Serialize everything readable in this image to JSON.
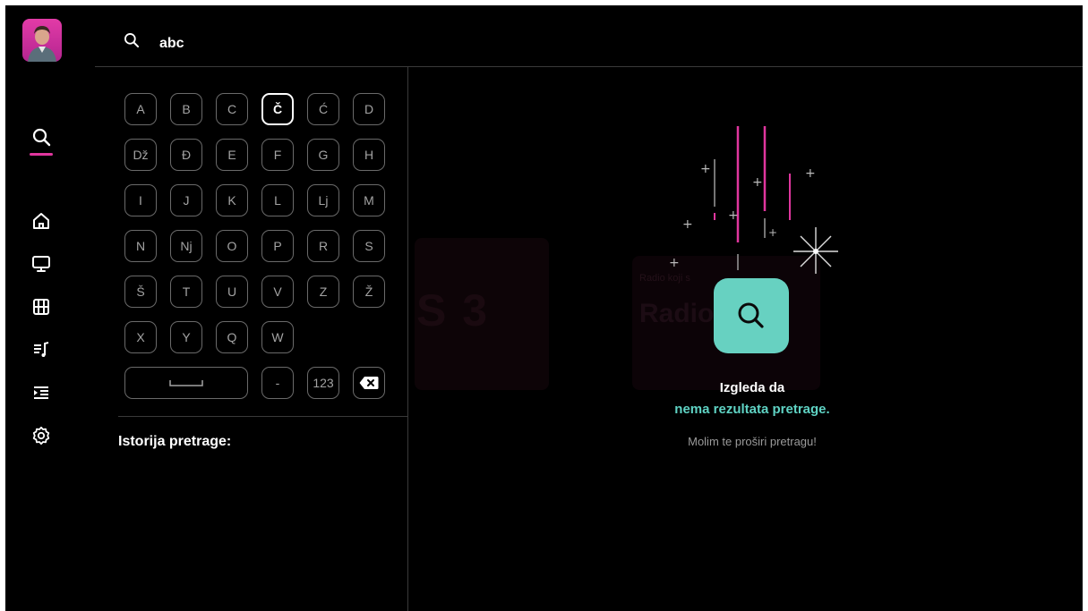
{
  "search": {
    "query": "abc"
  },
  "keyboard": {
    "focused": "Č",
    "rows": [
      [
        "A",
        "B",
        "C",
        "Č",
        "Ć",
        "D"
      ],
      [
        "Dž",
        "Đ",
        "E",
        "F",
        "G",
        "H"
      ],
      [
        "I",
        "J",
        "K",
        "L",
        "Lj",
        "M"
      ],
      [
        "N",
        "Nj",
        "O",
        "P",
        "R",
        "S"
      ],
      [
        "Š",
        "T",
        "U",
        "V",
        "Z",
        "Ž"
      ],
      [
        "X",
        "Y",
        "Q",
        "W"
      ]
    ],
    "dash": "-",
    "num": "123"
  },
  "history": {
    "title": "Istorija pretrage:"
  },
  "empty_state": {
    "line1": "Izgleda da",
    "line2": "nema rezultata pretrage.",
    "line3": "Molim te proširi pretragu!"
  },
  "background": {
    "tile1_text": "S 3",
    "tile2_small": "Radio koji s",
    "tile2_text": "Radio"
  },
  "sidebar": {
    "items": [
      {
        "icon": "search-icon",
        "active": true
      },
      {
        "icon": "home-icon"
      },
      {
        "icon": "tv-icon"
      },
      {
        "icon": "film-icon"
      },
      {
        "icon": "music-list-icon"
      },
      {
        "icon": "queue-list-icon"
      },
      {
        "icon": "settings-icon"
      }
    ]
  },
  "colors": {
    "accent": "#e0369e",
    "teal": "#67d1c1",
    "teal_text": "#5fd3c4"
  }
}
